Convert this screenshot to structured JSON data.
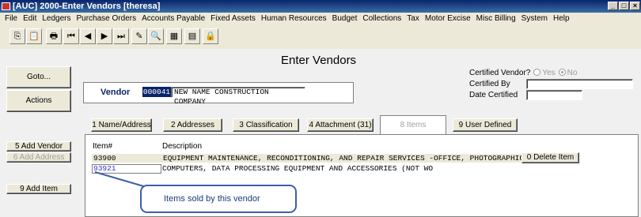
{
  "window": {
    "title": "[AUC] 2000-Enter Vendors [theresa]",
    "min": "_",
    "max": "□",
    "close": "×"
  },
  "menu": [
    "File",
    "Edit",
    "Ledgers",
    "Purchase Orders",
    "Accounts Payable",
    "Fixed Assets",
    "Human Resources",
    "Budget",
    "Collections",
    "Tax",
    "Motor Excise",
    "Misc Billing",
    "System",
    "Help"
  ],
  "toolbar": {
    "icons": [
      "copy-icon",
      "paste-icon",
      "print-icon",
      "first-record-icon",
      "prev-record-icon",
      "next-record-icon",
      "last-record-icon",
      "edit-icon",
      "search-icon",
      "spreadsheet-icon",
      "properties-icon",
      "lock-icon"
    ],
    "glyphs": [
      "⎘",
      "📋",
      "🖶",
      "⏮",
      "◀",
      "▶",
      "⏭",
      "✎",
      "🔍",
      "▦",
      "▤",
      "🔒"
    ]
  },
  "screen_title": "Enter Vendors",
  "left_buttons": {
    "goto": "Goto...",
    "actions": "Actions",
    "add_vendor": "5 Add Vendor",
    "add_address": "6 Add Address",
    "add_item": "9 Add Item"
  },
  "vendor": {
    "label": "Vendor",
    "number": "000041",
    "name": "NEW NAME CONSTRUCTION COMPANY"
  },
  "certified": {
    "label": "Certified Vendor?",
    "yes": "Yes",
    "no": "No",
    "selected": "No",
    "by_label": "Certified By",
    "by_value": "",
    "date_label": "Date Certified",
    "date_value": ""
  },
  "tabs": [
    "1 Name/Address",
    "2 Addresses",
    "3 Classification",
    "4 Attachment (31)",
    "8 Items",
    "9 User Defined"
  ],
  "items": {
    "header_item": "Item#",
    "header_desc": "Description",
    "rows": [
      {
        "item": "93900",
        "desc": "EQUIPMENT MAINTENANCE, RECONDITIONING, AND REPAIR SERVICES -OFFICE, PHOTOGRAPHIC"
      },
      {
        "item": "93921",
        "desc": "COMPUTERS, DATA PROCESSING EQUIPMENT AND ACCESSORIES (NOT WO"
      }
    ],
    "delete_button": "0 Delete Item"
  },
  "callout": "Items sold by this vendor"
}
